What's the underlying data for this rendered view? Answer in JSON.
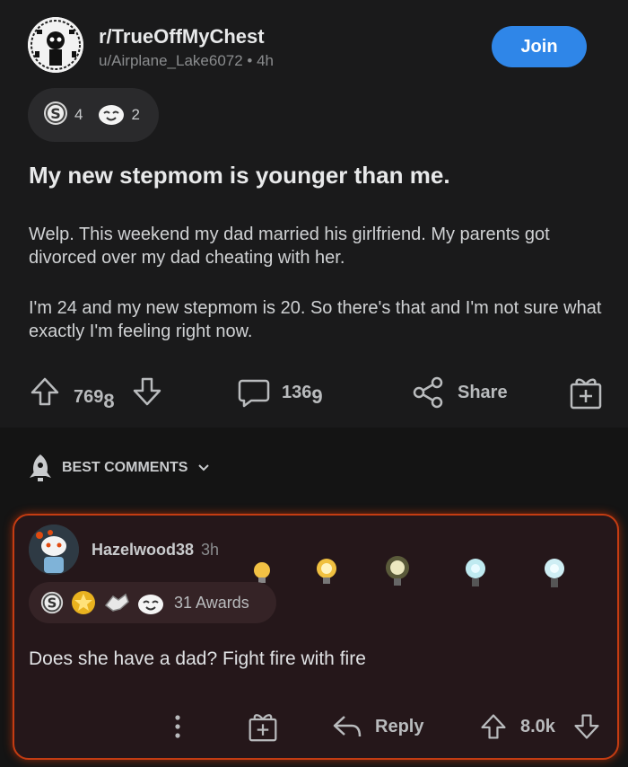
{
  "post": {
    "subreddit": "r/TrueOffMyChest",
    "meta": "u/Airplane_Lake6072 • 4h",
    "join_label": "Join",
    "awards": [
      {
        "icon": "silver-award-icon",
        "count": "4"
      },
      {
        "icon": "wholesome-award-icon",
        "count": "2"
      }
    ],
    "title": "My new stepmom is younger than me.",
    "body": [
      "Welp. This weekend my dad married his girlfriend. My parents got divorced over my dad cheating with her.",
      "I'm 24 and my new stepmom is 20. So there's that and I'm not sure what exactly I'm feeling right now."
    ],
    "upvotes_main": "769",
    "upvotes_sub": "8",
    "comments_main": "136",
    "comments_sub": "9",
    "share_label": "Share"
  },
  "sort": {
    "label": "BEST COMMENTS"
  },
  "comment": {
    "username": "Hazelwood38",
    "time": "3h",
    "awards_label": "31 Awards",
    "text": "Does she have a dad?  Fight fire with fire",
    "reply_label": "Reply",
    "score": "8.0k"
  },
  "colors": {
    "accent": "#2f86e8",
    "comment_border": "#c43c12",
    "background": "#1a1a1b"
  }
}
